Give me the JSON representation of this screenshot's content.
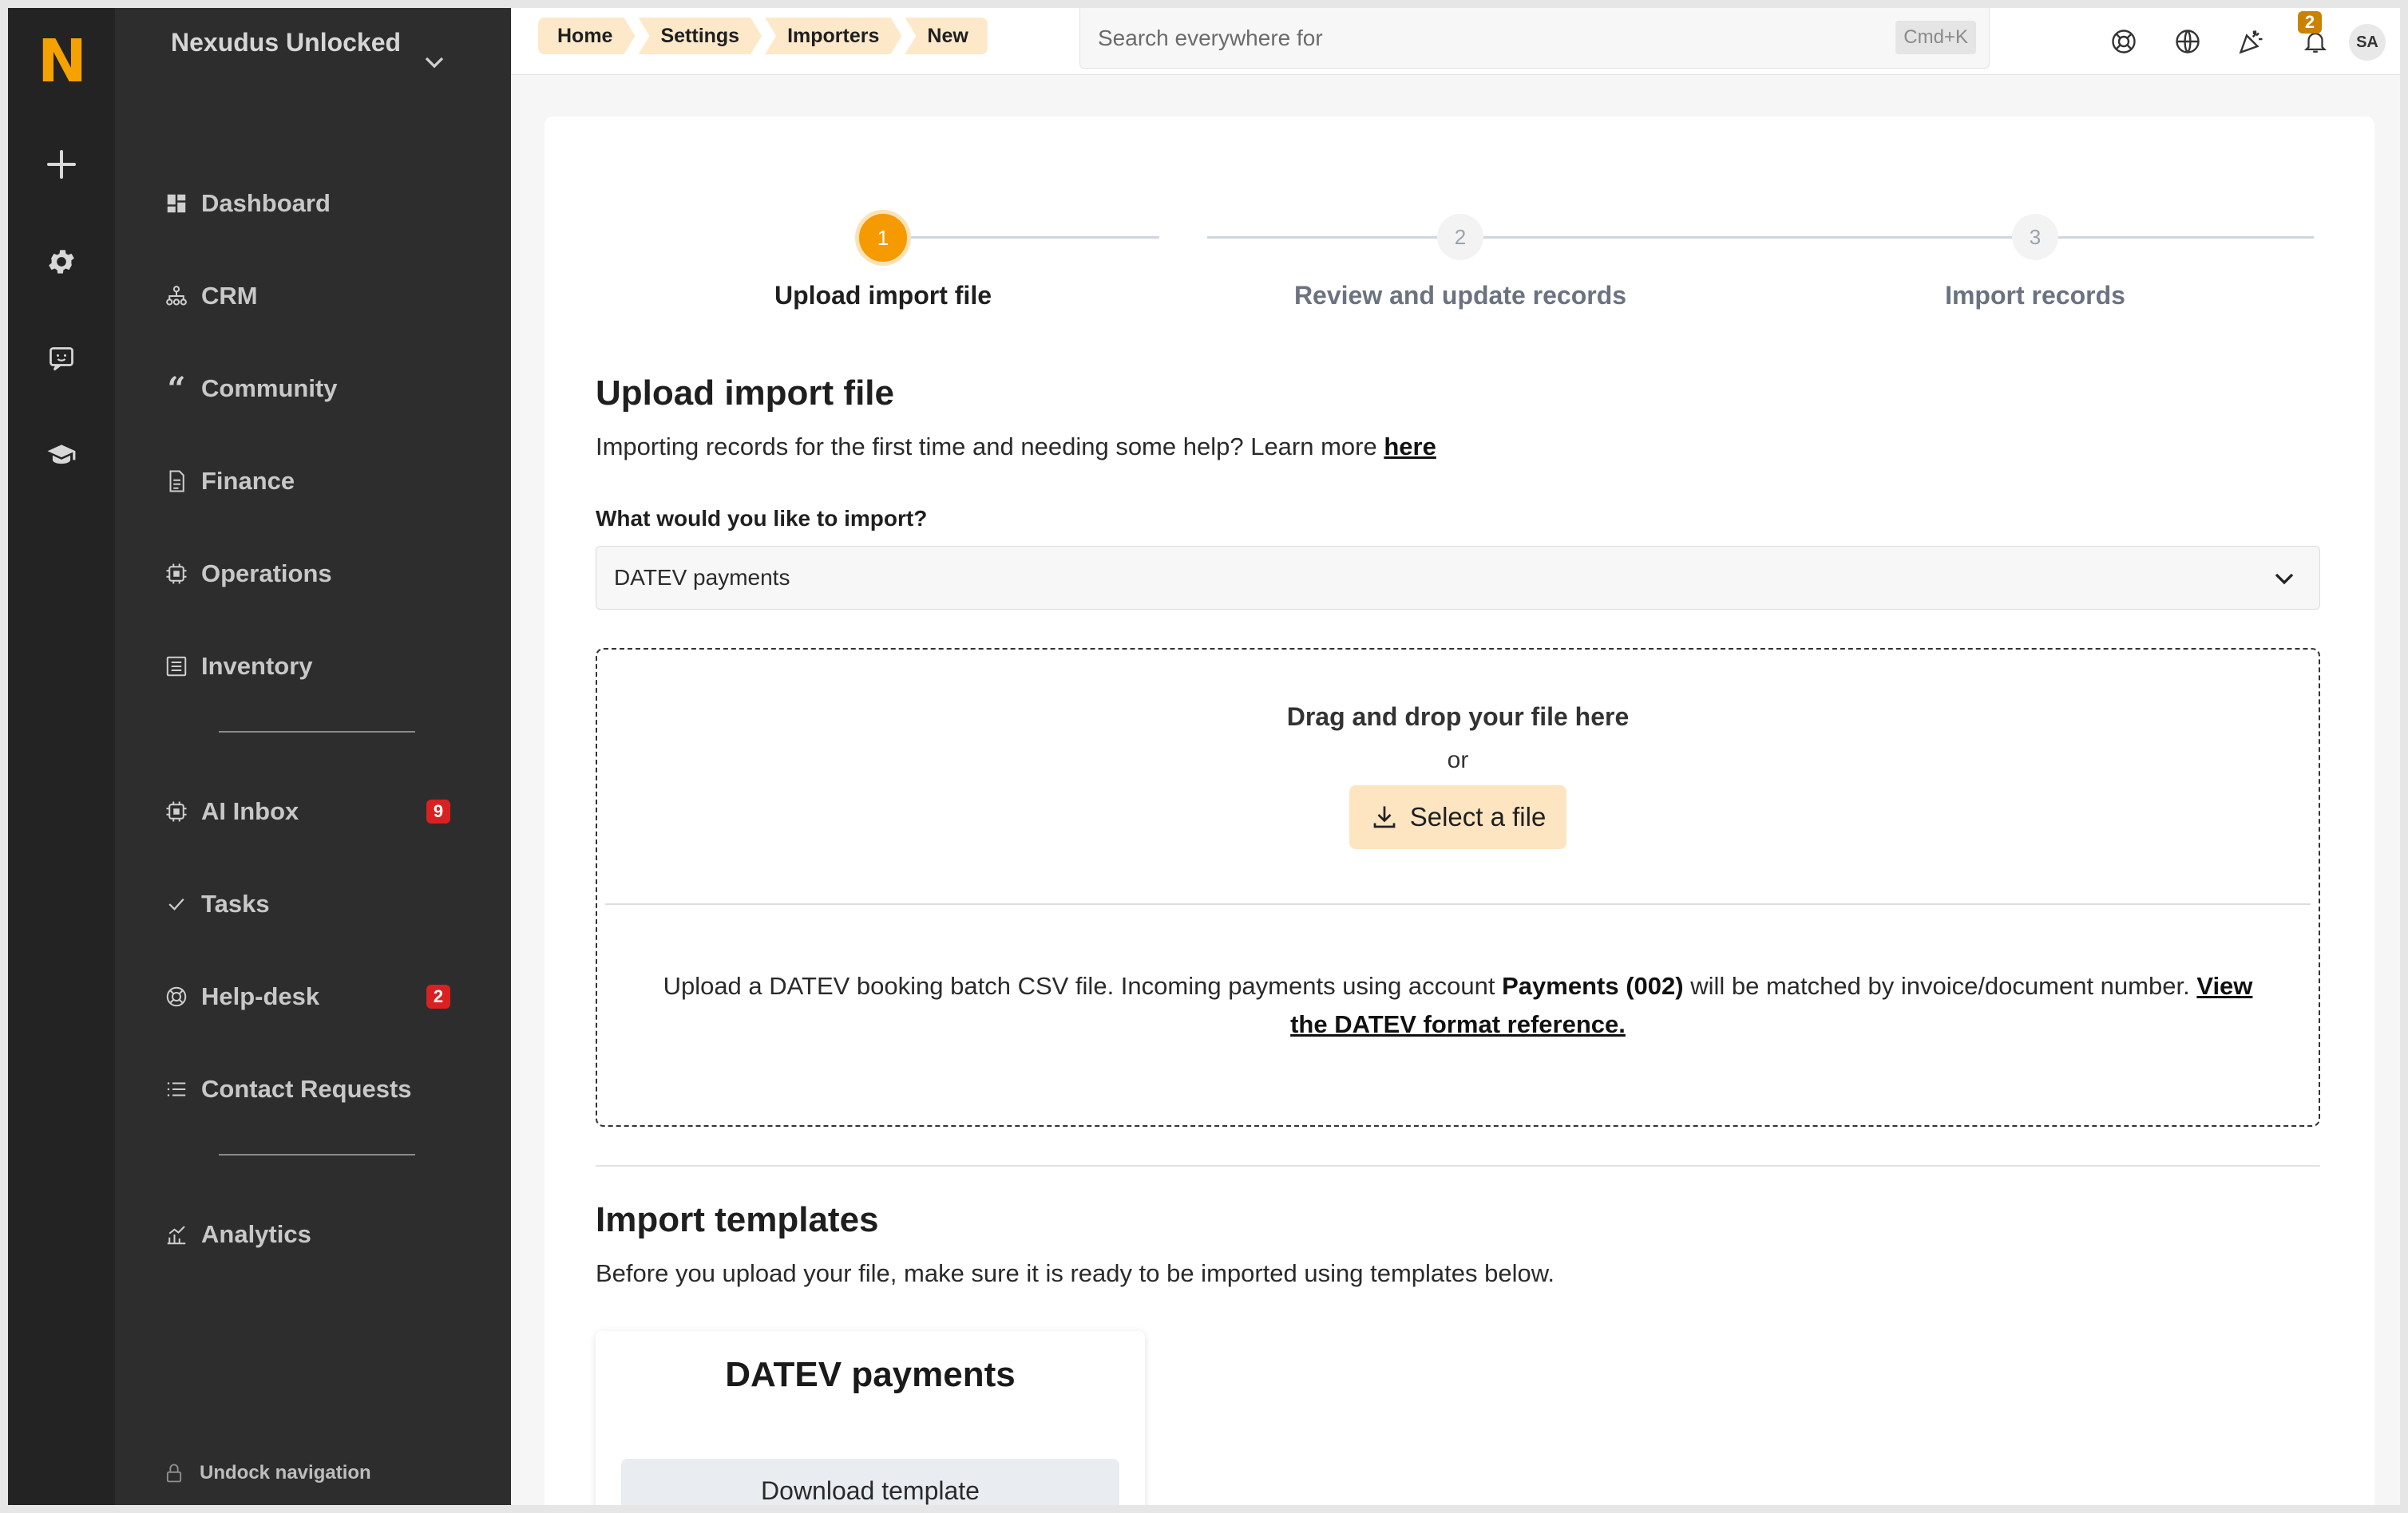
{
  "rail": {
    "logo": "N",
    "icons": [
      "plus-icon",
      "gear-icon",
      "chat-icon",
      "graduation-cap-icon"
    ]
  },
  "sidebar": {
    "org_name": "Nexudus Unlocked",
    "items": [
      {
        "label": "Dashboard",
        "icon": "dashboard-icon"
      },
      {
        "label": "CRM",
        "icon": "crm-icon"
      },
      {
        "label": "Community",
        "icon": "quote-icon"
      },
      {
        "label": "Finance",
        "icon": "document-icon"
      },
      {
        "label": "Operations",
        "icon": "chip-icon"
      },
      {
        "label": "Inventory",
        "icon": "list-box-icon"
      },
      {
        "label": "AI Inbox",
        "icon": "chip-icon",
        "badge": "9"
      },
      {
        "label": "Tasks",
        "icon": "check-icon"
      },
      {
        "label": "Help-desk",
        "icon": "lifebuoy-icon",
        "badge": "2"
      },
      {
        "label": "Contact Requests",
        "icon": "list-icon"
      },
      {
        "label": "Analytics",
        "icon": "chart-icon"
      }
    ],
    "undock_label": "Undock navigation"
  },
  "topbar": {
    "breadcrumbs": [
      "Home",
      "Settings",
      "Importers",
      "New"
    ],
    "search_placeholder": "Search everywhere for",
    "search_shortcut": "Cmd+K",
    "notification_count": "2",
    "avatar_initials": "SA"
  },
  "stepper": {
    "steps": [
      {
        "number": "1",
        "label": "Upload import file",
        "state": "active"
      },
      {
        "number": "2",
        "label": "Review and update records",
        "state": "inactive"
      },
      {
        "number": "3",
        "label": "Import records",
        "state": "inactive"
      }
    ]
  },
  "upload": {
    "title": "Upload import file",
    "intro": "Importing records for the first time and needing some help? Learn more",
    "intro_link": "here",
    "field_label": "What would you like to import?",
    "selected_option": "DATEV payments",
    "drop_title": "Drag and drop your file here",
    "drop_or": "or",
    "select_button": "Select a file",
    "help_before": "Upload a DATEV booking batch CSV file. Incoming payments using account",
    "help_bold": "Payments (002)",
    "help_after": "will be matched by invoice/document number.",
    "help_link": "View the DATEV format reference."
  },
  "templates": {
    "title": "Import templates",
    "intro": "Before you upload your file, make sure it is ready to be imported using templates below.",
    "card_title": "DATEV payments",
    "download_button": "Download template"
  },
  "colors": {
    "accent": "#f59a00",
    "breadcrumb_bg": "#fde9c9",
    "badge_red": "#d92121",
    "sidebar_bg": "#2d2d2d",
    "rail_bg": "#232323"
  }
}
